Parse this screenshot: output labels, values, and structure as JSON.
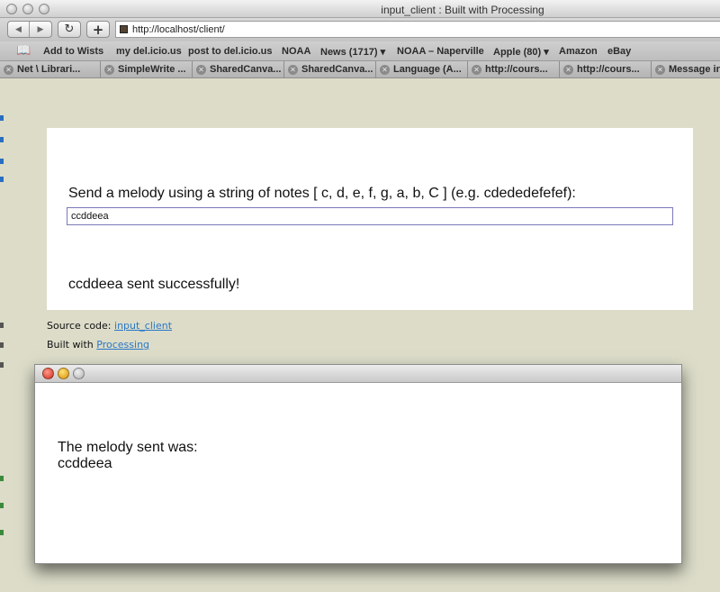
{
  "window": {
    "title": "input_client : Built with Processing"
  },
  "toolbar": {
    "back_icon": "back-arrow-icon",
    "forward_icon": "forward-arrow-icon",
    "reload_icon": "reload-icon",
    "add_icon": "plus-icon",
    "url": "http://localhost/client/"
  },
  "bookmarks": [
    "Add to Wists",
    "my del.icio.us",
    "post to del.icio.us",
    "NOAA",
    "News (1717) ▾",
    "NOAA – Naperville",
    "Apple (80) ▾",
    "Amazon",
    "eBay"
  ],
  "tabs": [
    "Net \\ Librari...",
    "SimpleWrite ...",
    "SharedCanva...",
    "SharedCanva...",
    "Language (A...",
    "http://cours...",
    "http://cours...",
    "Message in"
  ],
  "applet": {
    "prompt": "Send a melody using a string of notes [ c, d, e, f, g, a, b, C ] (e.g. cdededefefef):",
    "input_value": "ccddeea",
    "status": "ccddeea sent successfully!"
  },
  "page": {
    "source_label": "Source code: ",
    "source_link": "input_client",
    "built_label": "Built with ",
    "built_link": "Processing"
  },
  "processing_window": {
    "line1": "The melody sent was:",
    "line2": "ccddeea"
  }
}
